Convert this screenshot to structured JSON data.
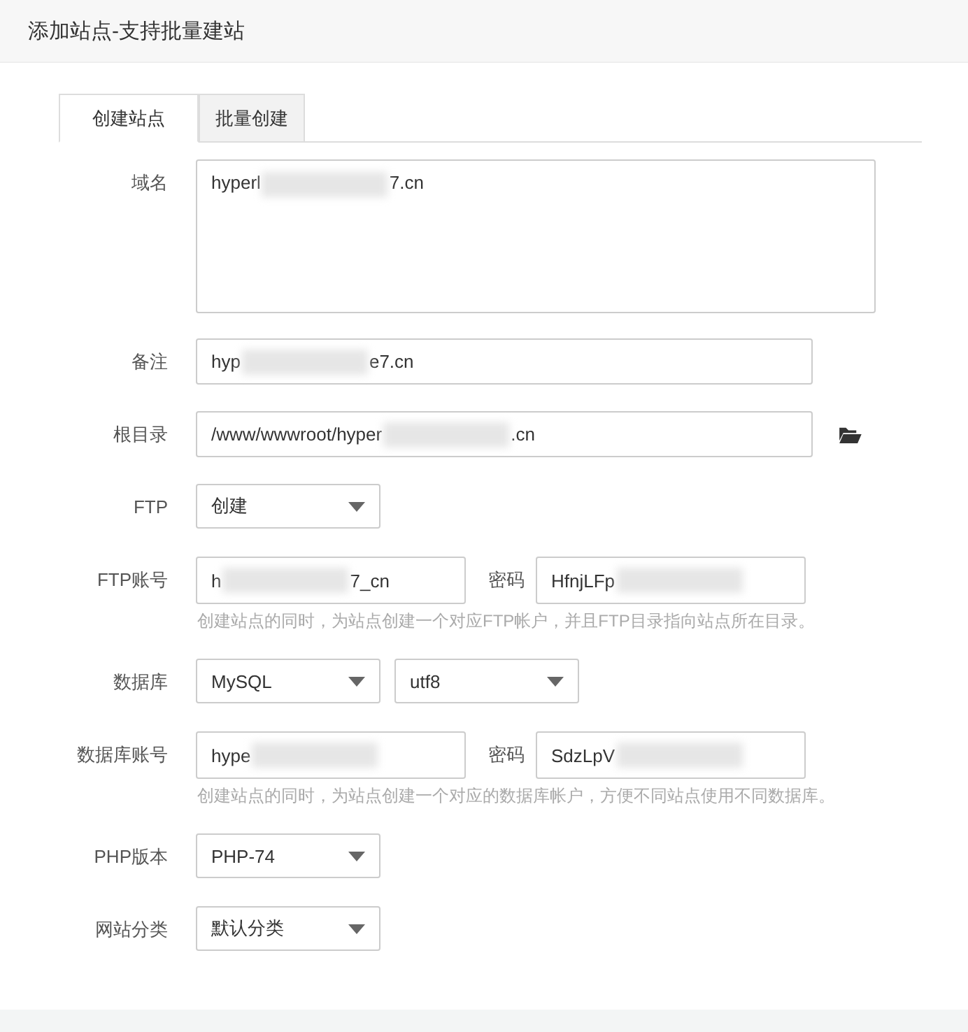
{
  "window": {
    "title": "添加站点-支持批量建站"
  },
  "tabs": [
    {
      "label": "创建站点",
      "selected": true
    },
    {
      "label": "批量创建",
      "selected": false
    }
  ],
  "rows": [
    {
      "kind": "textarea",
      "label": "域名",
      "fields": [
        {
          "value": "hyperl",
          "value_end": "7.cn",
          "redacted": true
        }
      ]
    },
    {
      "kind": "input",
      "label": "备注",
      "fields": [
        {
          "value": "hyp",
          "value_end": "e7.cn",
          "redacted": true
        }
      ]
    },
    {
      "kind": "input",
      "label": "根目录",
      "browse": true,
      "fields": [
        {
          "value": "/www/wwwroot/hyper",
          "value_end": ".cn",
          "redacted": true
        }
      ]
    },
    {
      "kind": "select",
      "label": "FTP",
      "selects": [
        {
          "value": "创建"
        }
      ]
    },
    {
      "kind": "pair",
      "label": "FTP账号",
      "fields": [
        {
          "value": "h",
          "value_end": "7_cn",
          "redacted": true
        },
        {
          "label": "密码",
          "value": "HfnjLFp",
          "redacted": true
        }
      ],
      "hint": "创建站点的同时，为站点创建一个对应FTP帐户，并且FTP目录指向站点所在目录。"
    },
    {
      "kind": "select",
      "label": "数据库",
      "selects": [
        {
          "value": "MySQL"
        },
        {
          "value": "utf8"
        }
      ]
    },
    {
      "kind": "pair",
      "label": "数据库账号",
      "fields": [
        {
          "value": "hype",
          "redacted": true
        },
        {
          "label": "密码",
          "value": "SdzLpV",
          "redacted": true
        }
      ],
      "hint": "创建站点的同时，为站点创建一个对应的数据库帐户，方便不同站点使用不同数据库。"
    },
    {
      "kind": "select",
      "label": "PHP版本",
      "selects": [
        {
          "value": "PHP-74"
        }
      ]
    },
    {
      "kind": "select",
      "label": "网站分类",
      "selects": [
        {
          "value": "默认分类"
        }
      ]
    }
  ]
}
